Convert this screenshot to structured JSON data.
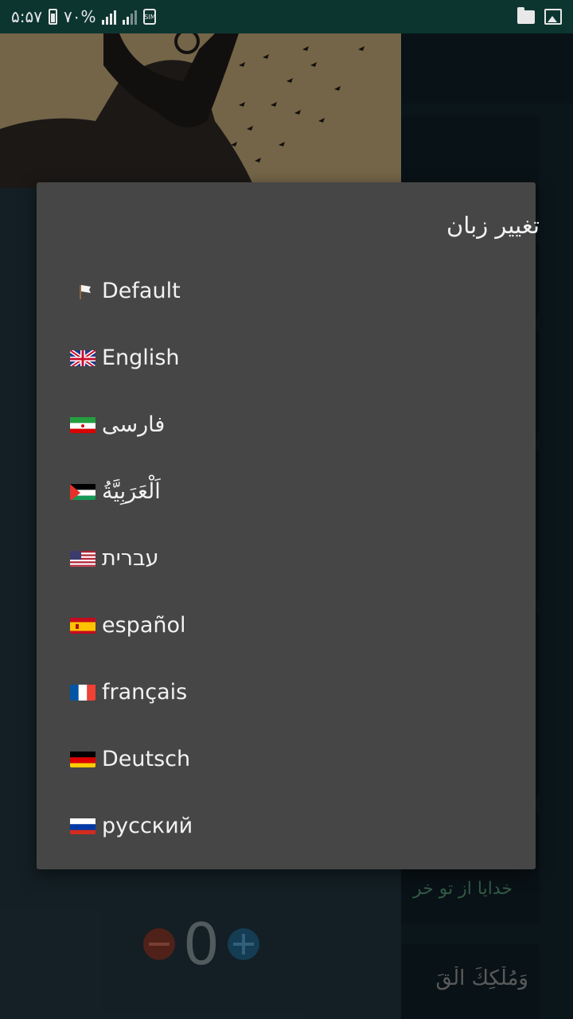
{
  "status_bar": {
    "time": "۵:۵۷",
    "battery": "۷۰%",
    "sim_label": "SIM"
  },
  "background": {
    "counter_value": "0",
    "card_text_1": "خدایا از تو خر",
    "card_text_2": "وَمُلْكِكَ الْقَ"
  },
  "dialog": {
    "title": "تغییر زبان",
    "items": [
      {
        "label": "Default",
        "flag_icon": "white-flag-icon"
      },
      {
        "label": "English",
        "flag_icon": "uk-flag-icon"
      },
      {
        "label": "فارسی",
        "flag_icon": "iran-flag-icon"
      },
      {
        "label": "اَلْعَرَبِيَّةُ",
        "flag_icon": "palestine-flag-icon"
      },
      {
        "label": "עברית",
        "flag_icon": "us-flag-icon"
      },
      {
        "label": "español",
        "flag_icon": "spain-flag-icon"
      },
      {
        "label": "français",
        "flag_icon": "france-flag-icon"
      },
      {
        "label": "Deutsch",
        "flag_icon": "germany-flag-icon"
      },
      {
        "label": "русский",
        "flag_icon": "russia-flag-icon"
      }
    ]
  },
  "colors": {
    "status_bar": "#0c3530",
    "dialog_background": "#464646",
    "dialog_text": "#f2f2f2",
    "minus_button": "#7a3326",
    "plus_button": "#1f5c7e"
  }
}
